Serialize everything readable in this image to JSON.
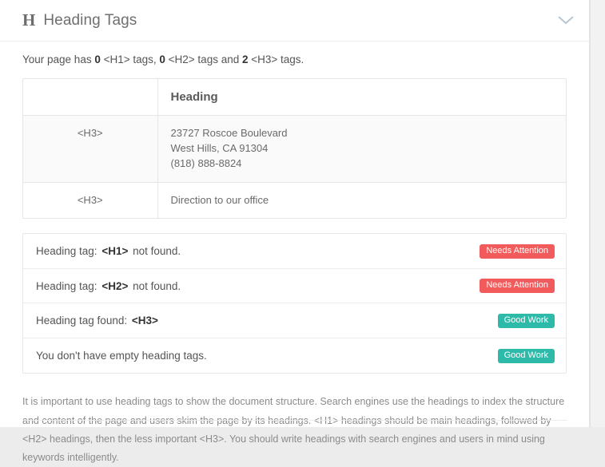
{
  "header": {
    "icon": "H",
    "icon_name": "heading-tag-icon",
    "title": "Heading Tags",
    "collapse_icon": "chevron-down-icon"
  },
  "summary": {
    "prefix": "Your page has ",
    "h1_count": "0",
    "mid1": " <H1> tags, ",
    "h2_count": "0",
    "mid2": " <H2> tags and ",
    "h3_count": "2",
    "suffix": " <H3> tags."
  },
  "table": {
    "columns": [
      "",
      "Heading"
    ],
    "rows": [
      {
        "tag": "<H3>",
        "value": "23727 Roscoe Boulevard\nWest Hills, CA 91304\n(818) 888-8824"
      },
      {
        "tag": "<H3>",
        "value": "Direction to our office"
      }
    ]
  },
  "checks": [
    {
      "label": "Heading tag:",
      "tag": "<H1>",
      "tail": "not found.",
      "badge": "Needs Attention",
      "badge_type": "attention",
      "badge_color": "#f15b5b"
    },
    {
      "label": "Heading tag:",
      "tag": "<H2>",
      "tail": "not found.",
      "badge": "Needs Attention",
      "badge_type": "attention",
      "badge_color": "#f15b5b"
    },
    {
      "label": "Heading tag found:",
      "tag": "<H3>",
      "tail": "",
      "badge": "Good Work",
      "badge_type": "good",
      "badge_color": "#2ebaa8"
    },
    {
      "label": "You don't have empty heading tags.",
      "tag": "",
      "tail": "",
      "badge": "Good Work",
      "badge_type": "good",
      "badge_color": "#2ebaa8"
    }
  ],
  "footnote": "It is important to use heading tags to show the document structure. Search engines use the headings to index the structure and content of the page and users skim the page by its headings. <H1> headings should be main headings, followed by <H2> headings, then the less important <H3>. You should write headings with search engines and users in mind using keywords intelligently."
}
